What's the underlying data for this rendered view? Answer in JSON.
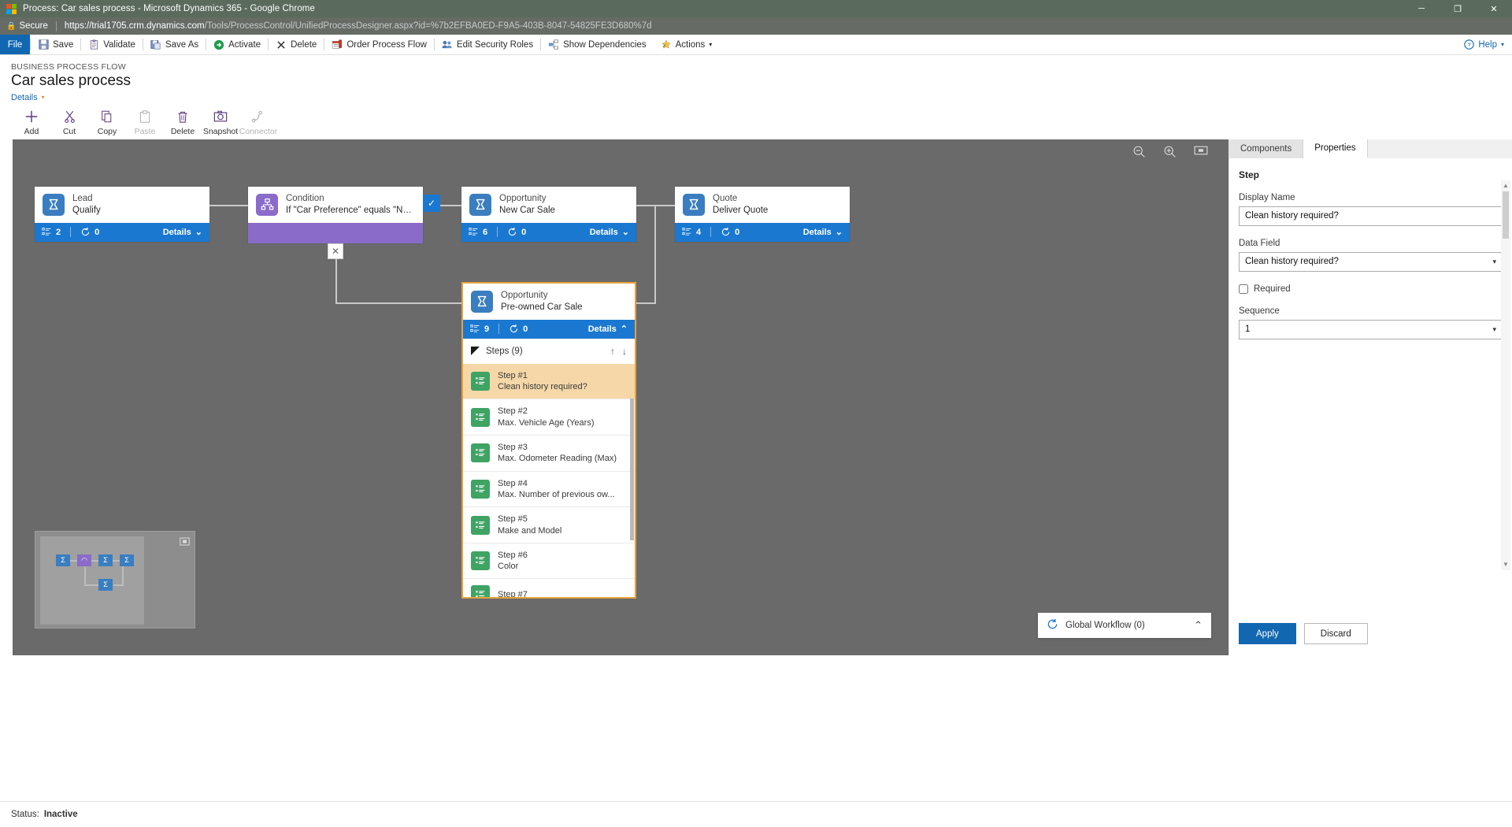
{
  "window": {
    "title": "Process: Car sales process - Microsoft Dynamics 365 - Google Chrome",
    "minimize": "─",
    "maximize": "❐",
    "close": "✕"
  },
  "browser": {
    "security_label": "Secure",
    "url_host": "https://trial1705.crm.dynamics.com",
    "url_path": "/Tools/ProcessControl/UnifiedProcessDesigner.aspx?id=%7b2EFBA0ED-F9A5-403B-8047-54825FE3D680%7d"
  },
  "commandbar": {
    "file": "File",
    "items": [
      {
        "label": "Save",
        "icon": "save-icon"
      },
      {
        "label": "Validate",
        "icon": "validate-icon"
      },
      {
        "label": "Save As",
        "icon": "save-as-icon"
      },
      {
        "label": "Activate",
        "icon": "activate-icon"
      },
      {
        "label": "Delete",
        "icon": "delete-icon"
      },
      {
        "label": "Order Process Flow",
        "icon": "order-process-flow-icon"
      },
      {
        "label": "Edit Security Roles",
        "icon": "edit-security-roles-icon"
      },
      {
        "label": "Show Dependencies",
        "icon": "show-dependencies-icon"
      },
      {
        "label": "Actions",
        "icon": "actions-icon",
        "caret": "▾"
      }
    ],
    "help": "Help",
    "help_caret": "▾"
  },
  "process": {
    "kicker": "BUSINESS PROCESS FLOW",
    "title": "Car sales process",
    "details_link": "Details",
    "details_caret": "▾"
  },
  "designer_toolbar": [
    {
      "label": "Add",
      "icon": "plus-icon",
      "disabled": false
    },
    {
      "label": "Cut",
      "icon": "scissors-icon",
      "disabled": false
    },
    {
      "label": "Copy",
      "icon": "copy-icon",
      "disabled": false
    },
    {
      "label": "Paste",
      "icon": "paste-icon",
      "disabled": true
    },
    {
      "label": "Delete",
      "icon": "trash-icon",
      "disabled": false
    },
    {
      "label": "Snapshot",
      "icon": "camera-icon",
      "disabled": false
    },
    {
      "label": "Connector",
      "icon": "connector-icon",
      "disabled": true
    }
  ],
  "canvas_tools": [
    {
      "name": "zoom-out-icon",
      "glyph": "zoom-out"
    },
    {
      "name": "zoom-in-icon",
      "glyph": "zoom-in"
    },
    {
      "name": "fit-to-screen-icon",
      "glyph": "fit"
    }
  ],
  "stages": [
    {
      "id": "lead",
      "entity": "Lead",
      "name": "Qualify",
      "steps_count": "2",
      "loops_count": "0",
      "details_label": "Details",
      "details_caret": "⌄",
      "icon": "stage-flag-icon",
      "icon_color": "#3a7ebf"
    },
    {
      "id": "condition",
      "entity": "Condition",
      "name": "If \"Car Preference\" equals \"New ...",
      "icon": "condition-branch-icon",
      "icon_color": "#8a6bc9",
      "checkmark": "✓"
    },
    {
      "id": "opportunity_new",
      "entity": "Opportunity",
      "name": "New Car Sale",
      "steps_count": "6",
      "loops_count": "0",
      "details_label": "Details",
      "details_caret": "⌄",
      "icon": "stage-flag-icon",
      "icon_color": "#3a7ebf"
    },
    {
      "id": "quote",
      "entity": "Quote",
      "name": "Deliver Quote",
      "steps_count": "4",
      "loops_count": "0",
      "details_label": "Details",
      "details_caret": "⌄",
      "icon": "stage-flag-icon",
      "icon_color": "#3a7ebf"
    },
    {
      "id": "opportunity_preowned",
      "entity": "Opportunity",
      "name": "Pre-owned Car Sale",
      "steps_count": "9",
      "loops_count": "0",
      "details_label": "Details",
      "details_caret": "⌃",
      "icon": "stage-flag-icon",
      "icon_color": "#3a7ebf"
    }
  ],
  "steps_panel": {
    "header": "Steps (9)",
    "move_up": "↑",
    "move_down": "↓",
    "items": [
      {
        "num": "Step #1",
        "label": "Clean history required?",
        "selected": true
      },
      {
        "num": "Step #2",
        "label": "Max. Vehicle Age (Years)",
        "selected": false
      },
      {
        "num": "Step #3",
        "label": "Max. Odometer Reading (Max)",
        "selected": false
      },
      {
        "num": "Step #4",
        "label": "Max. Number of previous ow...",
        "selected": false
      },
      {
        "num": "Step #5",
        "label": "Make and Model",
        "selected": false
      },
      {
        "num": "Step #6",
        "label": "Color",
        "selected": false
      },
      {
        "num": "Step #7",
        "label": "",
        "selected": false
      }
    ]
  },
  "global_workflow": {
    "label": "Global Workflow (0)",
    "icon": "workflow-loop-icon",
    "caret": "⌃"
  },
  "minimap": {
    "expand_icon": "expand-minimap-icon"
  },
  "properties_panel": {
    "tabs": [
      {
        "label": "Components",
        "active": false
      },
      {
        "label": "Properties",
        "active": true
      }
    ],
    "section_title": "Step",
    "display_name_label": "Display Name",
    "display_name_value": "Clean history required?",
    "data_field_label": "Data Field",
    "data_field_value": "Clean history required?",
    "data_field_caret": "▾",
    "required_label": "Required",
    "required_checked": false,
    "sequence_label": "Sequence",
    "sequence_value": "1",
    "sequence_caret": "▾",
    "apply_button": "Apply",
    "discard_button": "Discard"
  },
  "statusbar": {
    "label": "Status:",
    "value": "Inactive"
  },
  "colors": {
    "accent_blue": "#1267b1",
    "stage_footer_blue": "#1b78d0",
    "condition_purple": "#8a6bc9",
    "step_green": "#3fa364",
    "selection_amber": "#e5a33c",
    "canvas_gray": "#6a6a6a"
  }
}
